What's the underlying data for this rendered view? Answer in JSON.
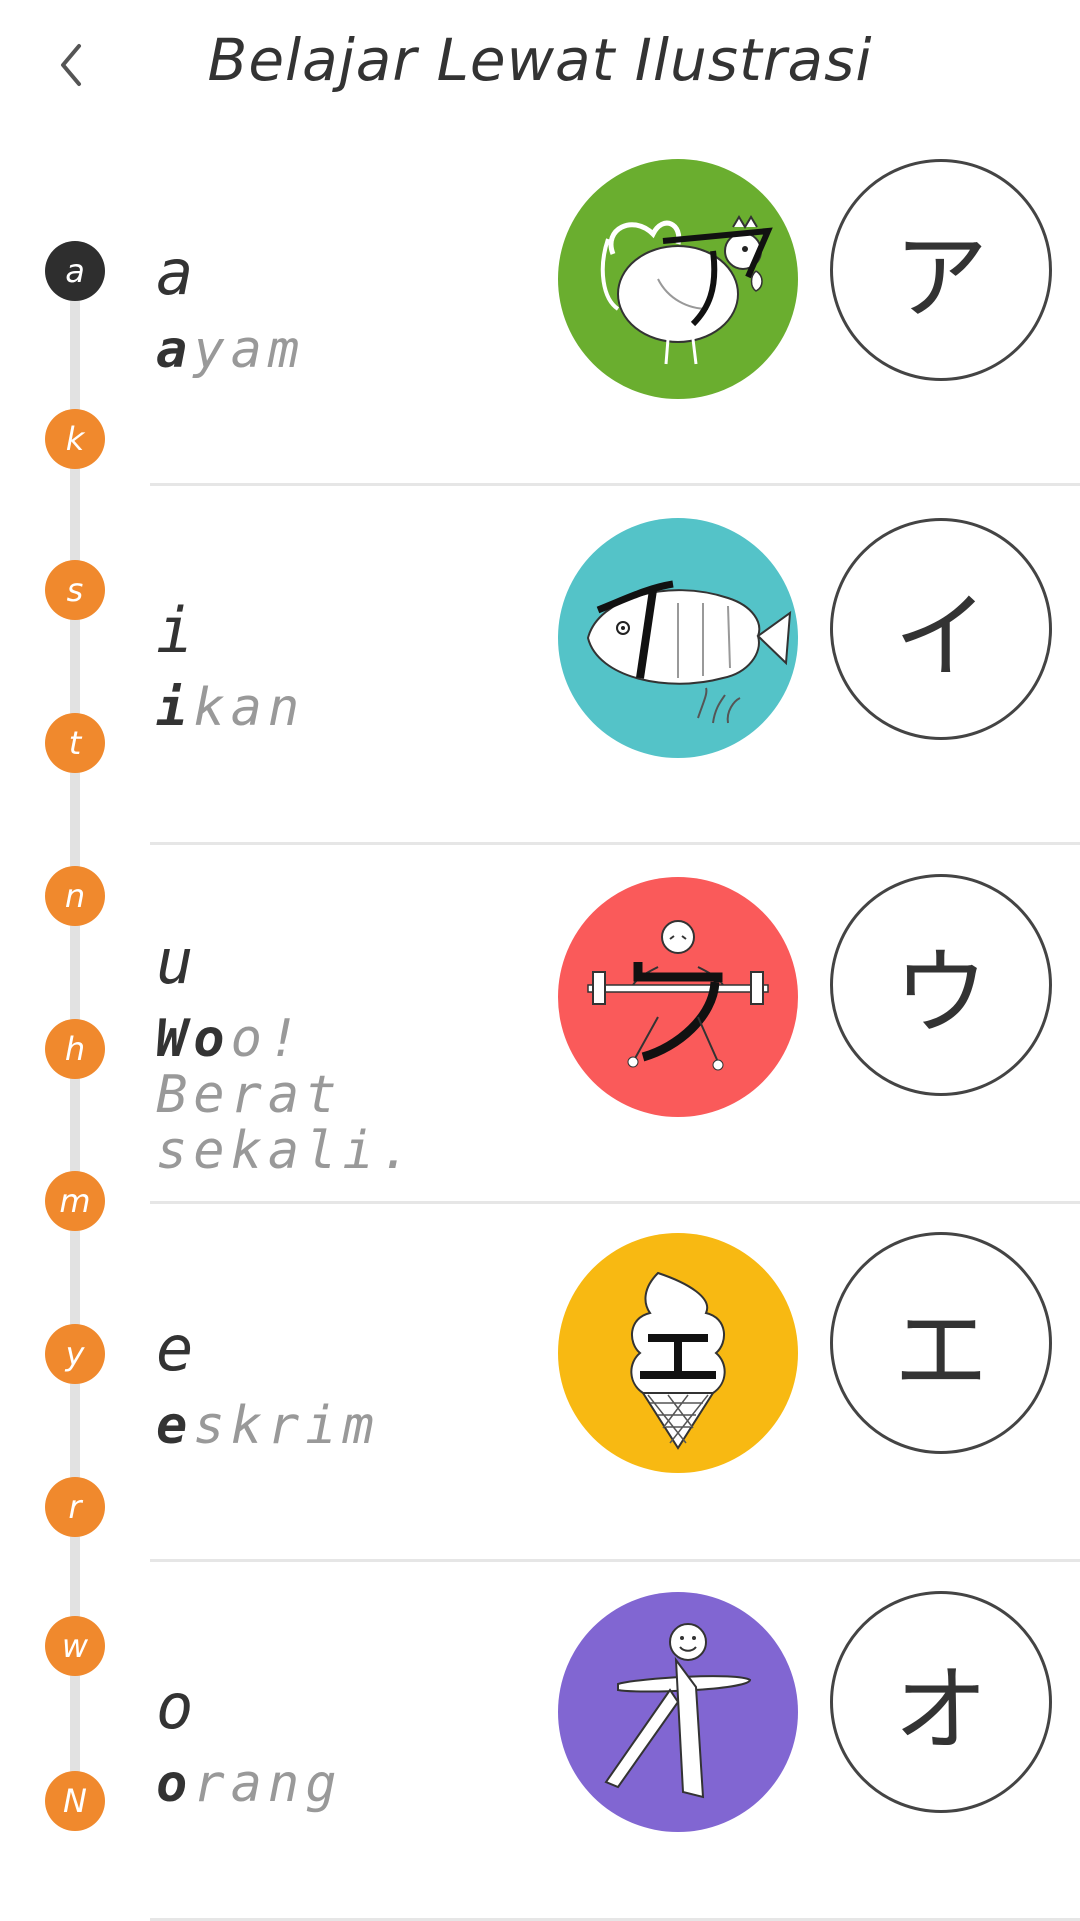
{
  "header": {
    "title": "Belajar Lewat Ilustrasi",
    "back_icon": "chevron-left-icon"
  },
  "index": [
    {
      "label": "a",
      "active": true
    },
    {
      "label": "k",
      "active": false
    },
    {
      "label": "s",
      "active": false
    },
    {
      "label": "t",
      "active": false
    },
    {
      "label": "n",
      "active": false
    },
    {
      "label": "h",
      "active": false
    },
    {
      "label": "m",
      "active": false
    },
    {
      "label": "y",
      "active": false
    },
    {
      "label": "r",
      "active": false
    },
    {
      "label": "w",
      "active": false
    },
    {
      "label": "N",
      "active": false
    }
  ],
  "colors": {
    "accent": "#f0892d",
    "active_index": "#2e2e2e",
    "chicken_bg": "#6aae2f",
    "fish_bg": "#54c3c8",
    "weight_bg": "#fa5a5a",
    "icecream_bg": "#f8b912",
    "person_bg": "#8166d2"
  },
  "rows": [
    {
      "romaji": "a",
      "word_head": "a",
      "word_tail": "yam",
      "kana": "ア",
      "illustration": "chicken-illustration"
    },
    {
      "romaji": "i",
      "word_head": "i",
      "word_tail": "kan",
      "kana": "イ",
      "illustration": "fish-illustration"
    },
    {
      "romaji": "u",
      "word_head": "Wo",
      "word_tail": "o! Berat sekali.",
      "kana": "ウ",
      "illustration": "weightlifter-illustration"
    },
    {
      "romaji": "e",
      "word_head": "e",
      "word_tail": "skrim",
      "kana": "エ",
      "illustration": "ice-cream-illustration"
    },
    {
      "romaji": "o",
      "word_head": "o",
      "word_tail": "rang",
      "kana": "オ",
      "illustration": "person-illustration"
    }
  ]
}
